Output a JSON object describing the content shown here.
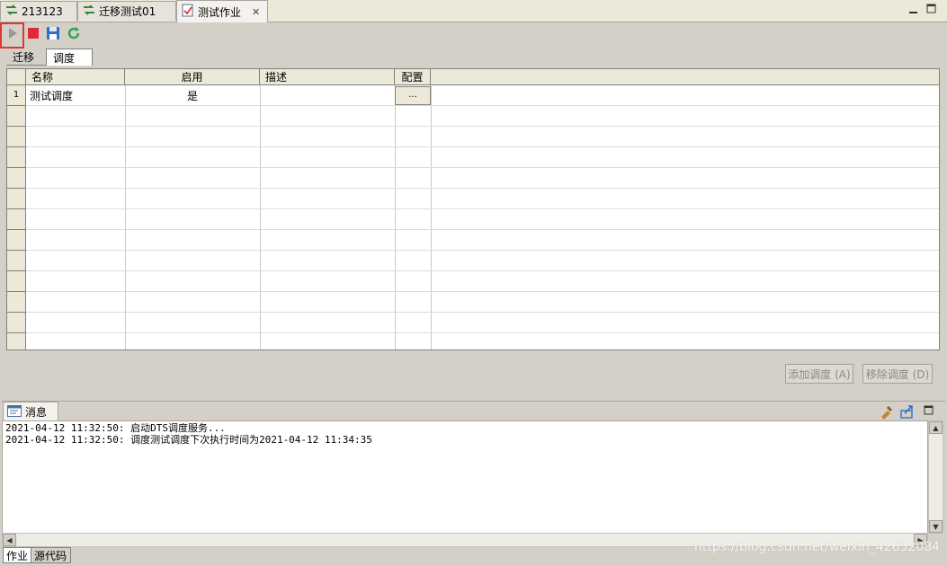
{
  "editor_tabs": [
    {
      "label": "213123"
    },
    {
      "label": "迁移测试01"
    },
    {
      "label": "测试作业",
      "active": true,
      "close_glyph": "✕"
    }
  ],
  "toolbar": {
    "run_icon": "play-icon",
    "stop_icon": "stop-icon",
    "save_icon": "save-icon",
    "refresh_icon": "refresh-icon"
  },
  "sub_tabs": [
    {
      "label": "迁移"
    },
    {
      "label": "调度",
      "active": true
    }
  ],
  "table": {
    "columns": [
      "名称",
      "启用",
      "描述",
      "配置"
    ],
    "rows": [
      {
        "index": "1",
        "name": "测试调度",
        "enabled": "是",
        "description": "",
        "config": "..."
      }
    ]
  },
  "actions": {
    "add_label": "添加调度 (A)",
    "remove_label": "移除调度 (D)"
  },
  "messages": {
    "tab_label": "消息",
    "lines": [
      "2021-04-12 11:32:50: 启动DTS调度服务...",
      "2021-04-12 11:32:50: 调度测试调度下次执行时间为2021-04-12 11:34:35"
    ]
  },
  "bottom_tabs": [
    {
      "label": "作业"
    },
    {
      "label": "源代码"
    }
  ],
  "watermark": "https://blog.csdn.net/weixin_42632084",
  "colors": {
    "highlight": "#e23434",
    "stop_red": "#e0293a",
    "save_blue": "#2f6fc8",
    "refresh_green": "#2fa64a"
  }
}
